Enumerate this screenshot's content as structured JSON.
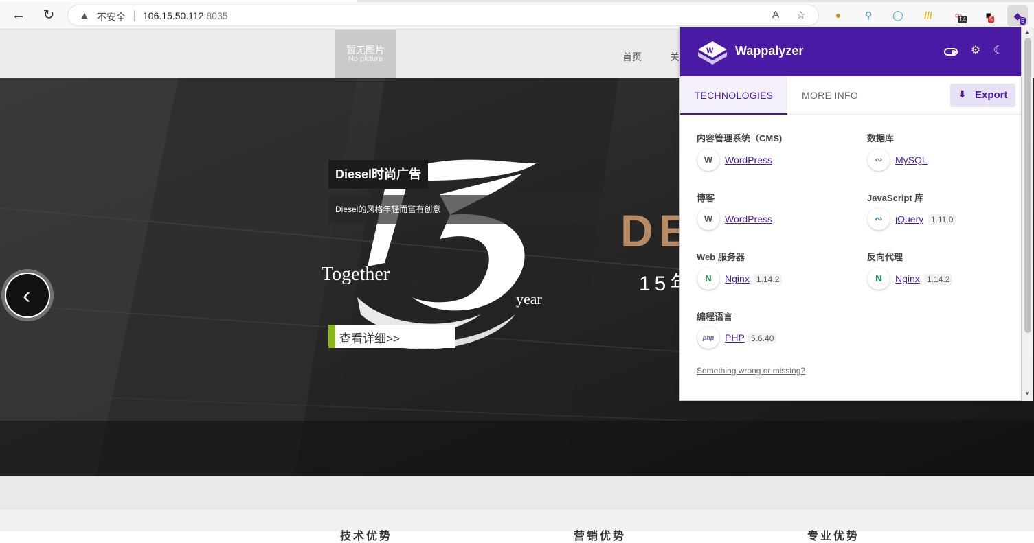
{
  "browser": {
    "back_icon": "back-arrow-icon",
    "reload_icon": "reload-icon",
    "insecure_label": "不安全",
    "url_host": "106.15.50.112",
    "url_port": ":8035",
    "extension_badges": [
      "14",
      "5",
      "5"
    ]
  },
  "site": {
    "logo_cn": "暂无图片",
    "logo_en": "No picture",
    "nav": [
      "首页",
      "关"
    ],
    "slide": {
      "title": "Diesel时尚广告",
      "description": "Diesel的风格年轻而富有创意",
      "link_label": "查看详细>>",
      "together_text": "Together",
      "year_text": "year",
      "brand_text": "DE",
      "brand_sub": "15年"
    },
    "footer_headings": [
      "技术优势",
      "营销优势",
      "专业优势"
    ]
  },
  "wappalyzer": {
    "title": "Wappalyzer",
    "tabs": [
      "TECHNOLOGIES",
      "MORE INFO"
    ],
    "export_label": "Export",
    "categories": [
      {
        "title": "内容管理系统（CMS)",
        "items": [
          {
            "name": "WordPress",
            "version": ""
          }
        ]
      },
      {
        "title": "数据库",
        "items": [
          {
            "name": "MySQL",
            "version": ""
          }
        ]
      },
      {
        "title": "博客",
        "items": [
          {
            "name": "WordPress",
            "version": ""
          }
        ]
      },
      {
        "title": "JavaScript 库",
        "items": [
          {
            "name": "jQuery",
            "version": "1.11.0"
          }
        ]
      },
      {
        "title": "Web 服务器",
        "items": [
          {
            "name": "Nginx",
            "version": "1.14.2"
          }
        ]
      },
      {
        "title": "反向代理",
        "items": [
          {
            "name": "Nginx",
            "version": "1.14.2"
          }
        ]
      },
      {
        "title": "编程语言",
        "items": [
          {
            "name": "PHP",
            "version": "5.6.40"
          }
        ]
      }
    ],
    "report_link": "Something wrong or missing?",
    "colors": {
      "header": "#4a1aa4",
      "nginx": "#0b9b3e",
      "brand": "#b68b66"
    }
  }
}
